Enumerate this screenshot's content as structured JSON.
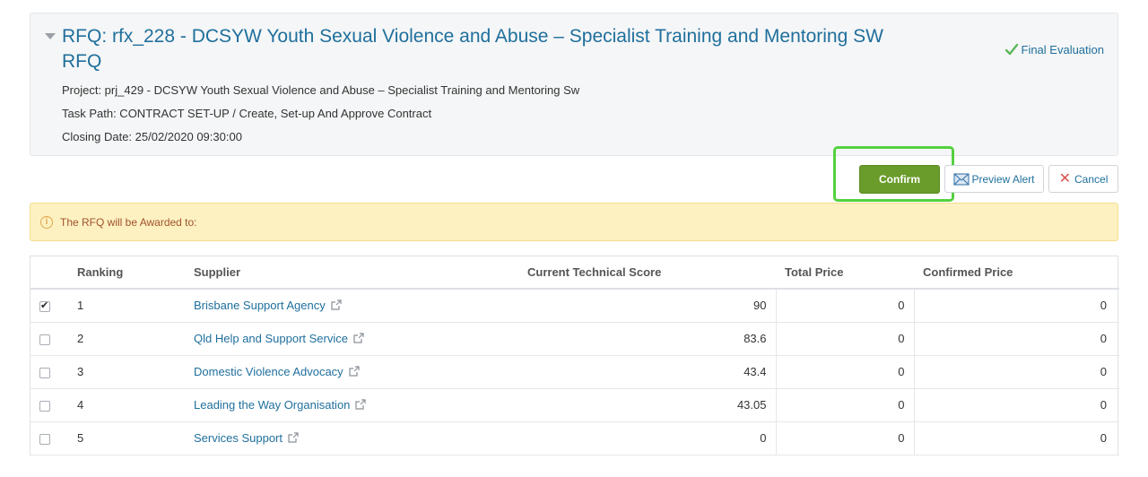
{
  "header": {
    "title": "RFQ: rfx_228 - DCSYW Youth Sexual Violence and Abuse – Specialist Training and Mentoring SW RFQ",
    "project": "Project: prj_429 - DCSYW Youth Sexual Violence and Abuse – Specialist Training and Mentoring Sw",
    "task_path": "Task Path: CONTRACT SET-UP / Create, Set-up And Approve Contract",
    "closing_date": "Closing Date: 25/02/2020 09:30:00",
    "status": "Final Evaluation"
  },
  "actions": {
    "confirm_label": "Confirm",
    "preview_label": "Preview Alert",
    "cancel_label": "Cancel"
  },
  "alert": {
    "text": "The RFQ will be Awarded to:"
  },
  "table": {
    "headers": {
      "ranking": "Ranking",
      "supplier": "Supplier",
      "technical_score": "Current Technical Score",
      "total_price": "Total Price",
      "confirmed_price": "Confirmed Price"
    },
    "rows": [
      {
        "checked": true,
        "ranking": "1",
        "supplier": "Brisbane Support Agency",
        "score": "90",
        "total": "0",
        "confirmed": "0"
      },
      {
        "checked": false,
        "ranking": "2",
        "supplier": "Qld Help and Support Service",
        "score": "83.6",
        "total": "0",
        "confirmed": "0"
      },
      {
        "checked": false,
        "ranking": "3",
        "supplier": "Domestic Violence Advocacy",
        "score": "43.4",
        "total": "0",
        "confirmed": "0"
      },
      {
        "checked": false,
        "ranking": "4",
        "supplier": "Leading the Way Organisation",
        "score": "43.05",
        "total": "0",
        "confirmed": "0"
      },
      {
        "checked": false,
        "ranking": "5",
        "supplier": "Services Support",
        "score": "0",
        "total": "0",
        "confirmed": "0"
      }
    ]
  },
  "colors": {
    "link": "#1f6f9c",
    "confirm": "#6a9c2b",
    "highlight": "#53d13f",
    "alert_bg": "#fdf1c1"
  },
  "icons": [
    "chevron-down-icon",
    "check-icon",
    "mail-icon",
    "close-icon",
    "info-icon",
    "external-link-icon"
  ]
}
